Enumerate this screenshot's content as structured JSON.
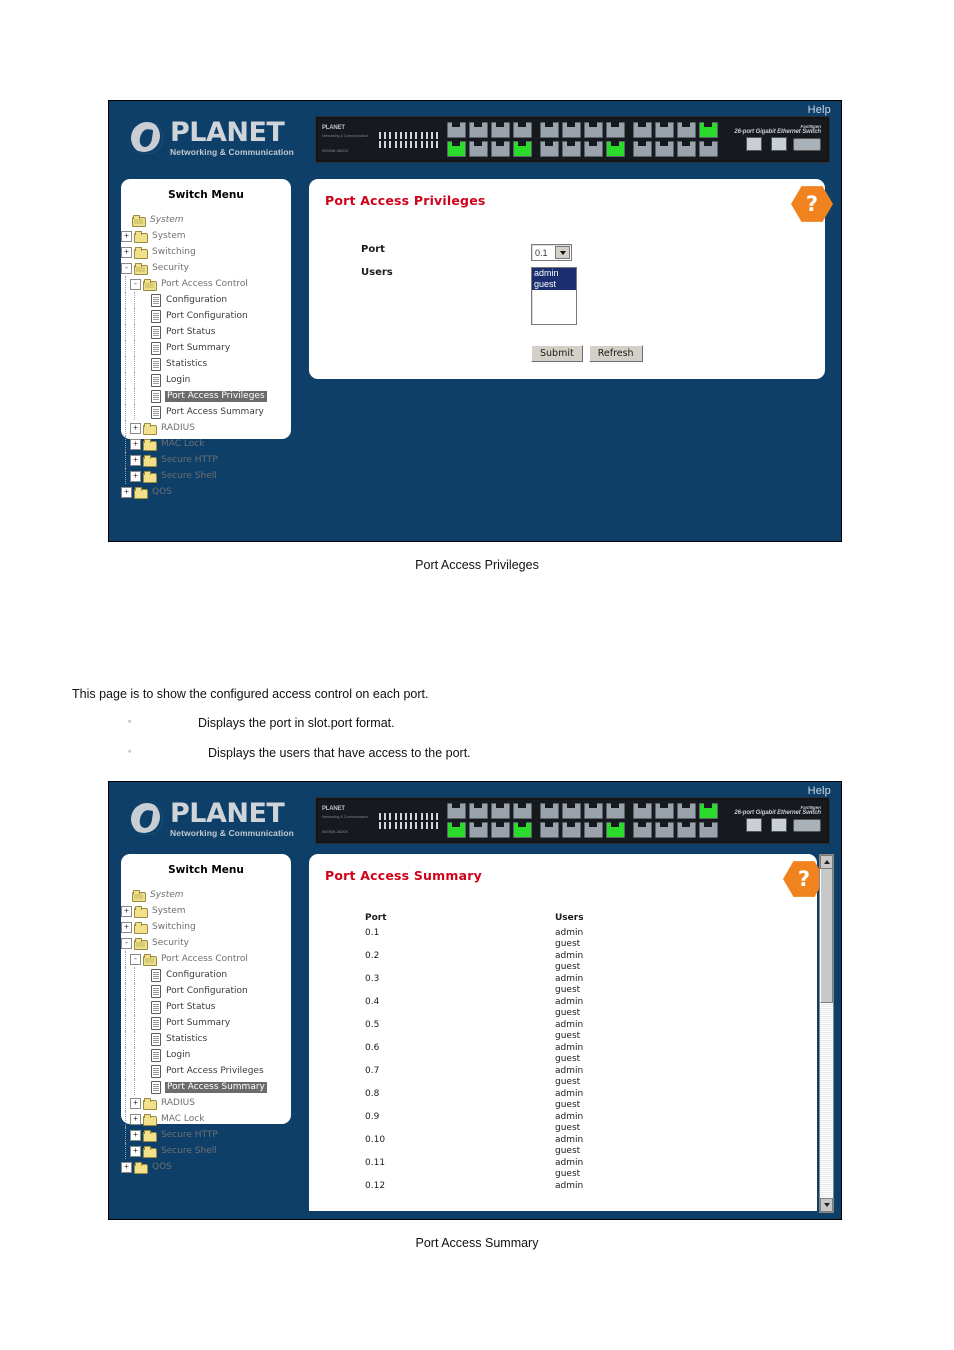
{
  "document": {
    "figure1_caption": "Port Access Privileges",
    "figure2_caption": "Port Access Summary",
    "paragraph": "This page is to show the configured access control on each port.",
    "bullets": [
      "Displays the port in slot.port format.",
      "Displays the users that have access to the port."
    ],
    "bullet_marker": "◦"
  },
  "ui": {
    "help_label": "Help",
    "brand": {
      "name": "PLANET",
      "tagline": "Networking & Communication"
    },
    "device": {
      "brand": "PLANET",
      "brand_sub": "Networking & Communication",
      "model": "WGSW-2620X",
      "series": "FastNgen",
      "description": "26-port Gigabit Ethernet Switch",
      "mini_gbic_label": "mini-GBIC",
      "console_label": "Console"
    },
    "menu_title": "Switch Menu",
    "help_badge_glyph": "?",
    "colors": {
      "window_blue": "#0d3f69",
      "title_red": "#d0021b",
      "badge_orange": "#f0831e",
      "selection_navy": "#1b2f70",
      "highlight_gray": "#6b6b6b"
    }
  },
  "tree": {
    "root": "System",
    "items": [
      {
        "label": "System",
        "level": 0,
        "icon": "folder-icon",
        "expander": "+"
      },
      {
        "label": "Switching",
        "level": 0,
        "icon": "folder-icon",
        "expander": "+"
      },
      {
        "label": "Security",
        "level": 0,
        "icon": "folder-open-icon",
        "expander": "-"
      },
      {
        "label": "Port Access Control",
        "level": 1,
        "icon": "folder-open-icon",
        "expander": "-"
      },
      {
        "label": "Configuration",
        "level": 2,
        "icon": "document-icon",
        "expander": ""
      },
      {
        "label": "Port Configuration",
        "level": 2,
        "icon": "document-icon",
        "expander": ""
      },
      {
        "label": "Port Status",
        "level": 2,
        "icon": "document-icon",
        "expander": ""
      },
      {
        "label": "Port Summary",
        "level": 2,
        "icon": "document-icon",
        "expander": ""
      },
      {
        "label": "Statistics",
        "level": 2,
        "icon": "document-icon",
        "expander": ""
      },
      {
        "label": "Login",
        "level": 2,
        "icon": "document-icon",
        "expander": ""
      },
      {
        "label": "Port Access Privileges",
        "level": 2,
        "icon": "document-icon",
        "expander": ""
      },
      {
        "label": "Port Access Summary",
        "level": 2,
        "icon": "document-icon",
        "expander": ""
      },
      {
        "label": "RADIUS",
        "level": 1,
        "icon": "folder-icon",
        "expander": "+"
      },
      {
        "label": "MAC Lock",
        "level": 1,
        "icon": "folder-icon",
        "expander": "+"
      },
      {
        "label": "Secure HTTP",
        "level": 1,
        "icon": "folder-icon",
        "expander": "+"
      },
      {
        "label": "Secure Shell",
        "level": 1,
        "icon": "folder-icon",
        "expander": "+"
      },
      {
        "label": "QOS",
        "level": 0,
        "icon": "folder-icon",
        "expander": "+"
      }
    ],
    "selected_fig1": "Port Access Privileges",
    "selected_fig2": "Port Access Summary"
  },
  "privileges_page": {
    "title": "Port Access Privileges",
    "port_label": "Port",
    "port_value": "0.1",
    "users_label": "Users",
    "users_options": [
      "admin",
      "guest"
    ],
    "users_selected": [
      "admin",
      "guest"
    ],
    "submit_label": "Submit",
    "refresh_label": "Refresh"
  },
  "summary_page": {
    "title": "Port Access Summary",
    "columns": [
      "Port",
      "Users"
    ],
    "rows": [
      {
        "port": "0.1",
        "users": [
          "admin",
          "guest"
        ]
      },
      {
        "port": "0.2",
        "users": [
          "admin",
          "guest"
        ]
      },
      {
        "port": "0.3",
        "users": [
          "admin",
          "guest"
        ]
      },
      {
        "port": "0.4",
        "users": [
          "admin",
          "guest"
        ]
      },
      {
        "port": "0.5",
        "users": [
          "admin",
          "guest"
        ]
      },
      {
        "port": "0.6",
        "users": [
          "admin",
          "guest"
        ]
      },
      {
        "port": "0.7",
        "users": [
          "admin",
          "guest"
        ]
      },
      {
        "port": "0.8",
        "users": [
          "admin",
          "guest"
        ]
      },
      {
        "port": "0.9",
        "users": [
          "admin",
          "guest"
        ]
      },
      {
        "port": "0.10",
        "users": [
          "admin",
          "guest"
        ]
      },
      {
        "port": "0.11",
        "users": [
          "admin",
          "guest"
        ]
      },
      {
        "port": "0.12",
        "users": [
          "admin"
        ]
      }
    ]
  }
}
